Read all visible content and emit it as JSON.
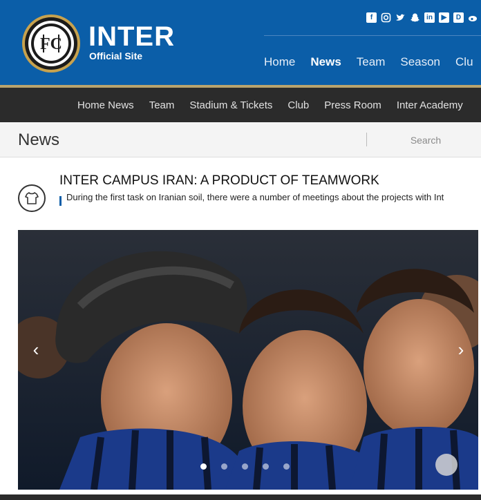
{
  "header": {
    "brand_name": "INTER",
    "brand_sub": "Official Site",
    "social_icons": [
      "facebook-icon",
      "instagram-icon",
      "twitter-icon",
      "snapchat-icon",
      "linkedin-icon",
      "youtube-icon",
      "dailymotion-icon",
      "weibo-icon"
    ],
    "main_nav": [
      "Home",
      "News",
      "Team",
      "Season",
      "Clu"
    ],
    "main_nav_active": "News"
  },
  "subnav": {
    "items": [
      "Home News",
      "Team",
      "Stadium & Tickets",
      "Club",
      "Press Room",
      "Inter Academy"
    ]
  },
  "section": {
    "title": "News",
    "search_placeholder": "Search"
  },
  "article": {
    "title": "INTER CAMPUS IRAN: A PRODUCT OF TEAMWORK",
    "excerpt": "During the first task on Iranian soil, there were a number of meetings about the projects with Int",
    "icon": "shirt-icon"
  },
  "carousel": {
    "slide_count": 5,
    "active_index": 0,
    "prev_icon": "chevron-left-icon",
    "next_icon": "chevron-right-icon"
  },
  "colors": {
    "header_blue": "#0b5ea8",
    "gold": "#b9a46e",
    "subnav_dark": "#2b2b2b"
  }
}
